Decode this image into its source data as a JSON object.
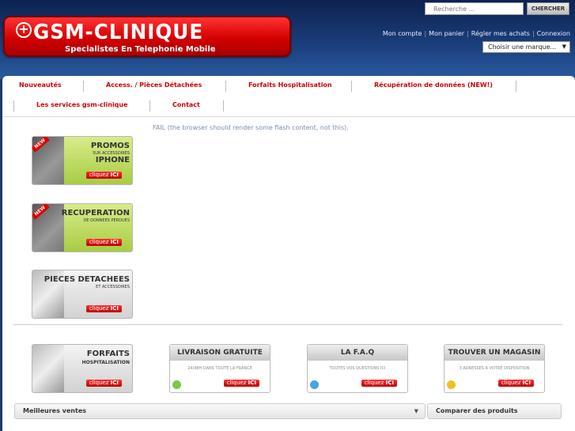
{
  "header": {
    "logo_name": "GSM-CLINIQUE",
    "logo_tagline": "Specialistes En Telephonie Mobile",
    "search_placeholder": "Recherche ...",
    "search_button": "CHERCHER",
    "account_links": [
      "Mon compte",
      "Mon panier",
      "Régler mes achats",
      "Connexion"
    ],
    "brand_select": "Choisir une marque..."
  },
  "nav": [
    "Nouveautés",
    "Access. / Pièces Détachées",
    "Forfaits Hospitalisation",
    "Récupération de données (NEW!)",
    "Les services gsm-clinique",
    "Contact"
  ],
  "flash_fallback": "FAIL (the browser should render some flash content, not this).",
  "promos": [
    {
      "ribbon": "NEW",
      "title": "PROMOS",
      "sub": "SUR ACCESSOIRES",
      "big": "IPHONE",
      "cta_pre": "cliquez ",
      "cta_b": "ICI"
    },
    {
      "ribbon": "NEW",
      "title": "RECUPERATION",
      "sub": "DE DONNEES PERDUES",
      "big": "",
      "cta_pre": "cliquez ",
      "cta_b": "ICI"
    },
    {
      "ribbon": "",
      "title": "PIECES DETACHEES",
      "sub": "ET ACCESSOIRES",
      "big": "",
      "cta_pre": "cliquez ",
      "cta_b": "ICI"
    }
  ],
  "bottom_banners": [
    {
      "title": "FORFAITS",
      "sub": "HOSPITALISATION",
      "cta_pre": "cliquez ",
      "cta_b": "ICI"
    },
    {
      "title": "LIVRAISON GRATUITE",
      "sub": "24/48H DANS TOUTE LA FRANCE",
      "cta_pre": "cliquez ",
      "cta_b": "ICI",
      "icon_color": "#7ac943"
    },
    {
      "title": "LA F.A.Q",
      "sub": "TOUTES VOS QUESTIONS ICI",
      "cta_pre": "cliquez ",
      "cta_b": "ICI",
      "icon_color": "#4aa3df"
    },
    {
      "title": "TROUVER UN MAGASIN",
      "sub": "3 ADRESSES A VOTRE DISPOSITION",
      "cta_pre": "cliquez ",
      "cta_b": "ICI",
      "icon_color": "#f0c020"
    }
  ],
  "best_sellers": "Meilleures ventes",
  "compare": "Comparer des produits",
  "colors": {
    "brand_red": "#d40000",
    "nav_text": "#cc0000",
    "header_blue": "#1a3d7a"
  }
}
